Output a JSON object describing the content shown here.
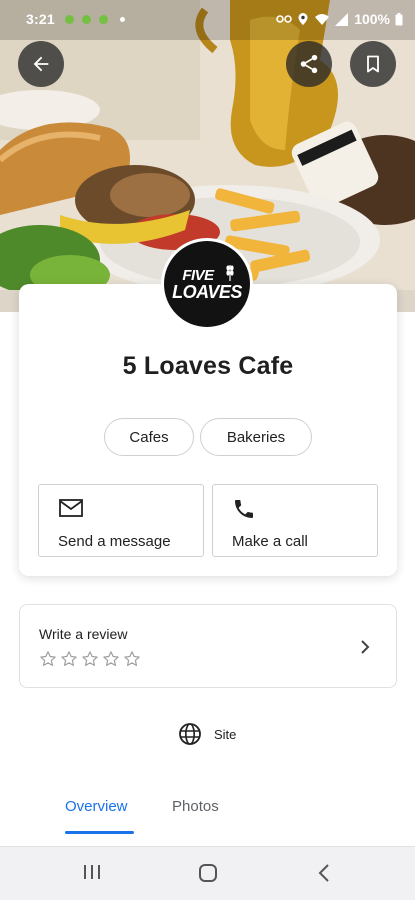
{
  "status_bar": {
    "time": "3:21",
    "battery": "100%"
  },
  "business": {
    "name": "5 Loaves Cafe",
    "logo_line1": "FIVE",
    "logo_line2": "LOAVES",
    "categories": [
      "Cafes",
      "Bakeries"
    ]
  },
  "actions": {
    "message_label": "Send a message",
    "call_label": "Make a call"
  },
  "review": {
    "title": "Write a review",
    "stars_total": 5,
    "stars_filled": 0
  },
  "site": {
    "label": "Site"
  },
  "tabs": [
    {
      "label": "Overview",
      "active": true
    },
    {
      "label": "Photos",
      "active": false
    }
  ],
  "colors": {
    "accent": "#1a73e8",
    "status_dots": "#74c043"
  },
  "icons": {
    "back": "arrow-left-icon",
    "share": "share-icon",
    "bookmark": "bookmark-icon",
    "message": "mail-icon",
    "call": "phone-icon",
    "site": "globe-icon",
    "chevron": "chevron-right-icon"
  }
}
